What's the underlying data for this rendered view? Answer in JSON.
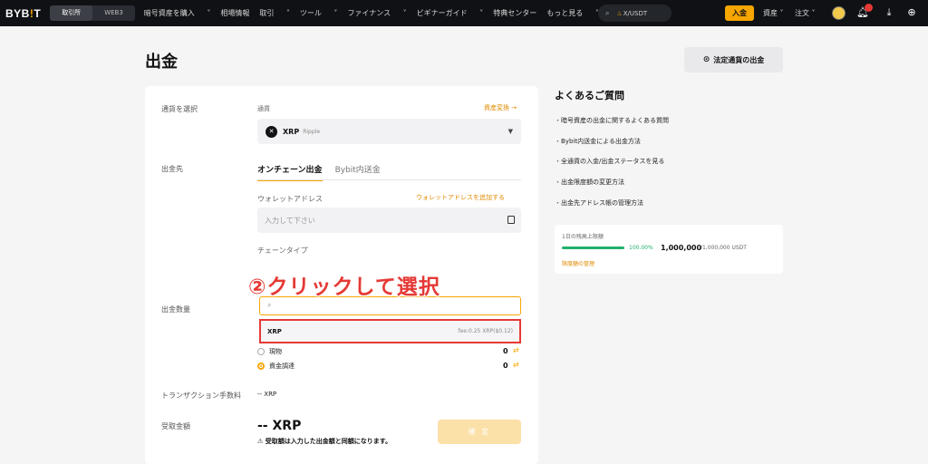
{
  "nav": {
    "logo_a": "BYB",
    "logo_b": "!",
    "logo_c": "T",
    "seg_exchange": "取引所",
    "seg_web3": "WEB3",
    "menu": [
      "暗号資産を購入",
      "相場情報",
      "取引",
      "ツール",
      "ファイナンス",
      "ビギナーガイド",
      "特典センター",
      "もっと見る"
    ],
    "search_text": "X/USDT",
    "deposit": "入金",
    "assets": "資産",
    "orders": "注文"
  },
  "page": {
    "title": "出金",
    "fiat_button": "法定通貨の出金"
  },
  "form": {
    "select_currency_label": "通貨を選択",
    "currency_label": "通貨",
    "convert_link": "資産変換",
    "currency_symbol": "XRP",
    "currency_name": "Ripple",
    "destination_label": "出金先",
    "tab_onchain": "オンチェーン出金",
    "tab_internal": "Bybit内送金",
    "wallet_label": "ウォレットアドレス",
    "add_wallet_link": "ウォレットアドレスを追加する",
    "wallet_placeholder": "入力して下さい",
    "chain_type_label": "チェーンタイプ",
    "amount_label": "出金数量",
    "option_name": "XRP",
    "option_fee": "fee:0.25  XRP($0.12)",
    "spot_label": "現物",
    "spot_amount": "0",
    "funding_label": "資金調達",
    "funding_amount": "0",
    "fee_label": "トランザクション手数料",
    "fee_value": "-- XRP",
    "receive_label": "受取金額",
    "receive_value": "-- XRP",
    "receive_note": "受取額は入力した出金額と同額になります。",
    "confirm": "確 定"
  },
  "overlay": {
    "text": "②クリックして選択"
  },
  "faq": {
    "title": "よくあるご質問",
    "items": [
      "暗号資産の出金に関するよくある質問",
      "Bybit内送金による出金方法",
      "全通貨の入金/出金ステータスを見る",
      "出金限度額の変更方法",
      "出金先アドレス帳の管理方法"
    ]
  },
  "limit": {
    "title": "1日の残高上限額",
    "percent": "100.00%",
    "value": "1,000,000",
    "total": "/1,000,000 USDT",
    "manage_link": "限度額の管理",
    "fill_fraction": 1.0
  },
  "colors": {
    "accent": "#f7a600",
    "highlight": "#e53935",
    "progress": "#20b26c"
  }
}
